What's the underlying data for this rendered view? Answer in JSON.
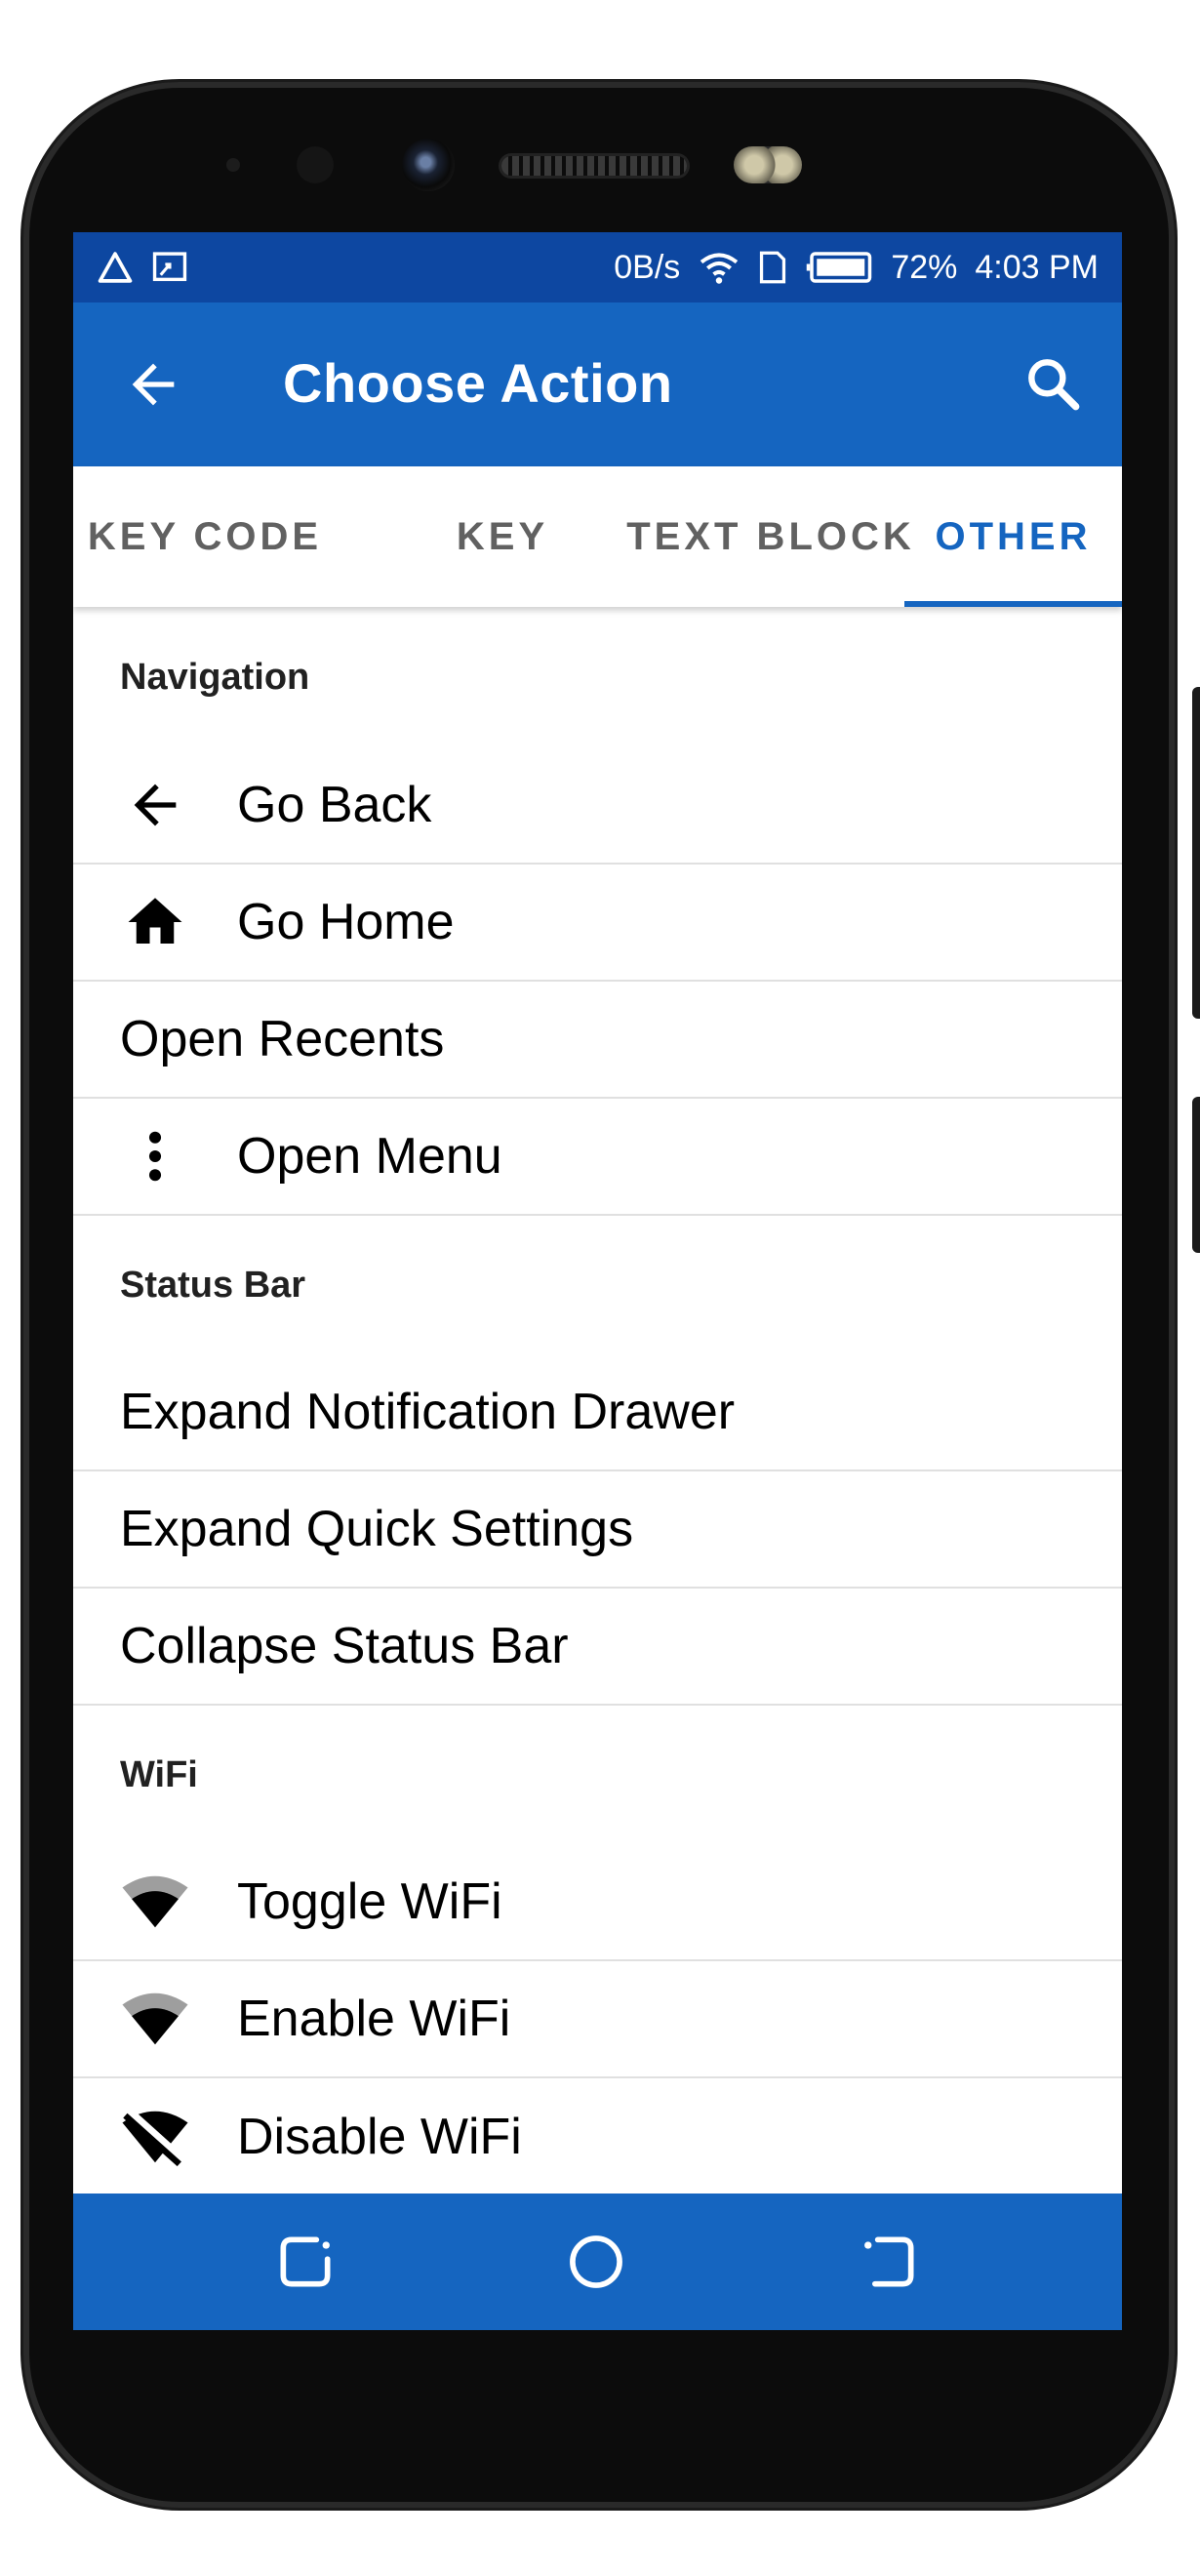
{
  "status_bar": {
    "left_icons": [
      "warning-outline-icon",
      "cast-icon"
    ],
    "speed": "0B/s",
    "battery": "72%",
    "time": "4:03 PM"
  },
  "app_bar": {
    "title": "Choose Action"
  },
  "tabs": [
    {
      "label": "KEY CODE",
      "active": false
    },
    {
      "label": "KEY",
      "active": false
    },
    {
      "label": "TEXT BLOCK",
      "active": false
    },
    {
      "label": "OTHER",
      "active": true
    }
  ],
  "sections": {
    "navigation": {
      "header": "Navigation",
      "items": [
        {
          "label": "Go Back",
          "icon": "arrow-back-icon"
        },
        {
          "label": "Go Home",
          "icon": "home-icon"
        },
        {
          "label": "Open Recents",
          "icon": ""
        },
        {
          "label": "Open Menu",
          "icon": "more-vert-icon"
        }
      ]
    },
    "status_bar": {
      "header": "Status Bar",
      "items": [
        {
          "label": "Expand Notification Drawer"
        },
        {
          "label": "Expand Quick Settings"
        },
        {
          "label": "Collapse Status Bar"
        }
      ]
    },
    "wifi": {
      "header": "WiFi",
      "items": [
        {
          "label": "Toggle WiFi",
          "icon": "wifi-icon"
        },
        {
          "label": "Enable WiFi",
          "icon": "wifi-icon"
        },
        {
          "label": "Disable WiFi",
          "icon": "wifi-off-icon"
        }
      ]
    }
  },
  "colors": {
    "status_bar": "#0d47a1",
    "primary": "#1565c0",
    "tab_inactive": "#616161",
    "divider": "#e0e0e0"
  }
}
